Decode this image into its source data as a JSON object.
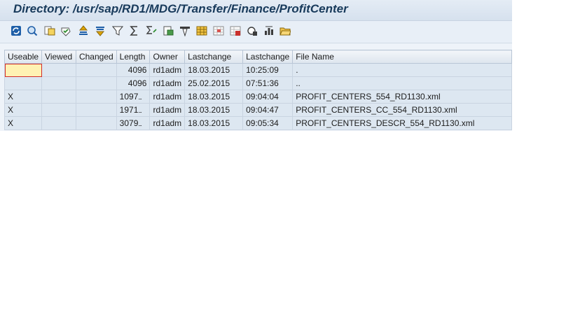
{
  "window": {
    "title": "Directory: /usr/sap/RD1/MDG/Transfer/Finance/ProfitCenter"
  },
  "toolbar": {
    "buttons": [
      {
        "icon": "refresh-icon",
        "name": "refresh-button"
      },
      {
        "icon": "find-icon",
        "name": "find-button"
      },
      {
        "icon": "details-icon",
        "name": "details-button"
      },
      {
        "icon": "check-icon",
        "name": "check-button"
      },
      {
        "icon": "sort-ascending-icon",
        "name": "sort-ascending-button"
      },
      {
        "icon": "sort-descending-icon",
        "name": "sort-descending-button"
      },
      {
        "icon": "filter-icon",
        "name": "filter-button"
      },
      {
        "icon": "sum-icon",
        "name": "total-button"
      },
      {
        "icon": "subtotal-icon",
        "name": "subtotal-button"
      },
      {
        "icon": "print-preview-icon",
        "name": "print-preview-button"
      },
      {
        "icon": "export-icon",
        "name": "export-button"
      },
      {
        "icon": "choose-layout-icon",
        "name": "choose-layout-button"
      },
      {
        "icon": "change-layout-icon",
        "name": "change-layout-button"
      },
      {
        "icon": "save-layout-icon",
        "name": "save-layout-button"
      },
      {
        "icon": "abc-analysis-icon",
        "name": "abc-analysis-button"
      },
      {
        "icon": "graphic-icon",
        "name": "graphic-button"
      },
      {
        "icon": "views-icon",
        "name": "views-button"
      },
      {
        "icon": "folder-open-icon",
        "name": "open-folder-button"
      }
    ]
  },
  "grid": {
    "columns": [
      "Useable",
      "Viewed",
      "Changed",
      "Length",
      "Owner",
      "Lastchange",
      "Lastchange",
      "File Name"
    ],
    "rows": [
      {
        "useable": "",
        "viewed": "",
        "changed": "",
        "length": "4096",
        "owner": "rd1adm",
        "date": "18.03.2015",
        "time": "10:25:09",
        "file": "."
      },
      {
        "useable": "",
        "viewed": "",
        "changed": "",
        "length": "4096",
        "owner": "rd1adm",
        "date": "25.02.2015",
        "time": "07:51:36",
        "file": ".."
      },
      {
        "useable": "X",
        "viewed": "",
        "changed": "",
        "length": "1097",
        "owner": "rd1adm",
        "date": "18.03.2015",
        "time": "09:04:04",
        "file": "PROFIT_CENTERS_554_RD1130.xml"
      },
      {
        "useable": "X",
        "viewed": "",
        "changed": "",
        "length": "1971",
        "owner": "rd1adm",
        "date": "18.03.2015",
        "time": "09:04:47",
        "file": "PROFIT_CENTERS_CC_554_RD1130.xml"
      },
      {
        "useable": "X",
        "viewed": "",
        "changed": "",
        "length": "3079",
        "owner": "rd1adm",
        "date": "18.03.2015",
        "time": "09:05:34",
        "file": "PROFIT_CENTERS_DESCR_554_RD1130.xml"
      }
    ]
  }
}
